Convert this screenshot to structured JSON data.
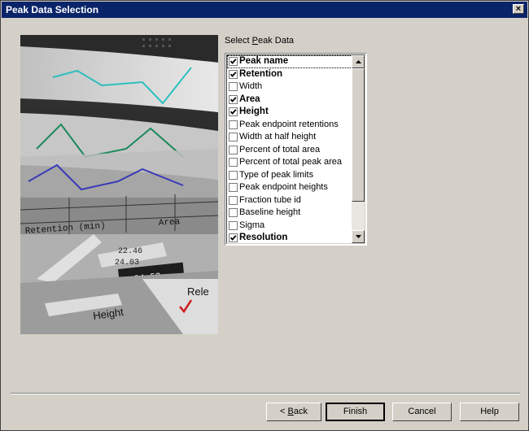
{
  "window": {
    "title": "Peak Data Selection",
    "close_label": "×"
  },
  "label": {
    "prefix": "Select ",
    "mnemonic": "P",
    "rest": "eak Data"
  },
  "items": [
    {
      "label": "Peak name",
      "checked": true
    },
    {
      "label": "Retention",
      "checked": true
    },
    {
      "label": "Width",
      "checked": false
    },
    {
      "label": "Area",
      "checked": true
    },
    {
      "label": "Height",
      "checked": true
    },
    {
      "label": "Peak endpoint retentions",
      "checked": false
    },
    {
      "label": "Width at half height",
      "checked": false
    },
    {
      "label": "Percent of total area",
      "checked": false
    },
    {
      "label": "Percent of total peak area",
      "checked": false
    },
    {
      "label": "Type of peak limits",
      "checked": false
    },
    {
      "label": "Peak endpoint heights",
      "checked": false
    },
    {
      "label": "Fraction tube id",
      "checked": false
    },
    {
      "label": "Baseline height",
      "checked": false
    },
    {
      "label": "Sigma",
      "checked": false
    },
    {
      "label": "Resolution",
      "checked": true
    }
  ],
  "picture_text": {
    "retention": "Retention (min)",
    "area": "Area",
    "val1": "22.46",
    "val2": "24.03",
    "val3": "24.53",
    "height": "Height",
    "rel": "Rele"
  },
  "buttons": {
    "back_prefix": "< ",
    "back_mnemonic": "B",
    "back_rest": "ack",
    "finish": "Finish",
    "cancel": "Cancel",
    "help": "Help"
  },
  "colors": {
    "titlebar": "#0a246a",
    "face": "#d4d0c8",
    "check": "#000000"
  }
}
